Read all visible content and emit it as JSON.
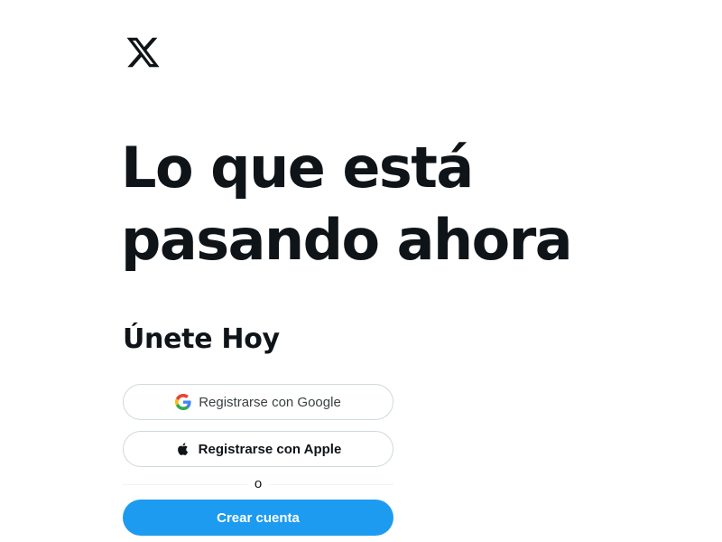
{
  "logo": {
    "icon": "x-logo-icon"
  },
  "hero": {
    "headline_line1": "Lo que está",
    "headline_line2": "pasando ahora",
    "subheading": "Únete Hoy"
  },
  "signup": {
    "google_label": "Registrarse con Google",
    "apple_label": "Registrarse con Apple",
    "divider_text": "o",
    "create_account_label": "Crear cuenta"
  },
  "colors": {
    "text": "#0f1419",
    "accent": "#1d9bf0",
    "border": "#cfd9de",
    "background": "#ffffff"
  }
}
